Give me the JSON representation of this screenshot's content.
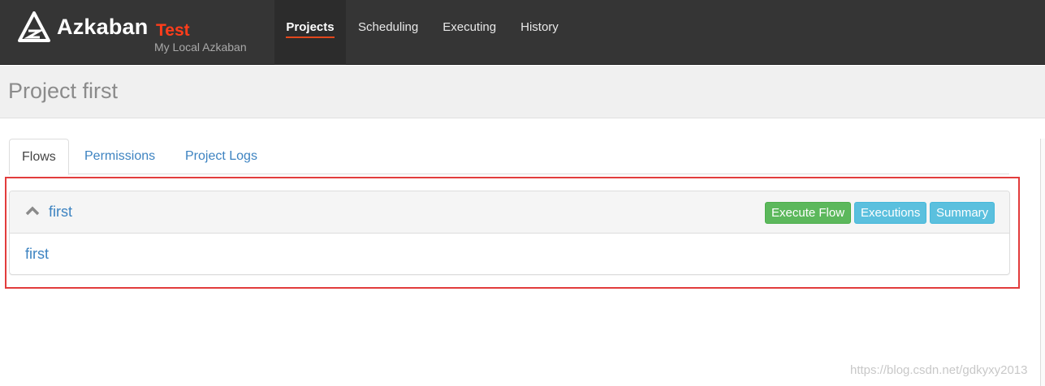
{
  "header": {
    "brand": "Azkaban",
    "environment": "Test",
    "subtitle": "My Local Azkaban",
    "nav": [
      {
        "label": "Projects",
        "active": true
      },
      {
        "label": "Scheduling",
        "active": false
      },
      {
        "label": "Executing",
        "active": false
      },
      {
        "label": "History",
        "active": false
      }
    ]
  },
  "page": {
    "title": "Project first"
  },
  "tabs": [
    {
      "label": "Flows",
      "active": true
    },
    {
      "label": "Permissions",
      "active": false
    },
    {
      "label": "Project Logs",
      "active": false
    }
  ],
  "flow": {
    "name": "first",
    "expanded": true,
    "buttons": {
      "execute": "Execute Flow",
      "executions": "Executions",
      "summary": "Summary"
    },
    "jobs": [
      "first"
    ]
  },
  "watermark": "https://blog.csdn.net/gdkyxy2013",
  "colors": {
    "navbar": "#353535",
    "accent": "#ff3d1b",
    "link": "#3d83c1",
    "success": "#5cb85c",
    "info": "#5bc0de",
    "highlight": "#e23c3c"
  },
  "icons": {
    "brand": "azkaban-logo-icon",
    "collapse": "chevron-up-icon"
  }
}
